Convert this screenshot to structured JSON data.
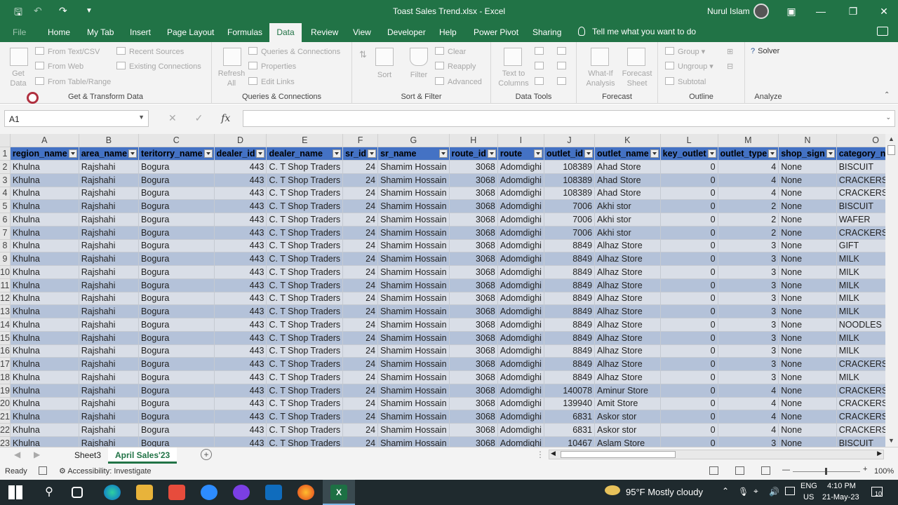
{
  "window": {
    "title": "Toast Sales Trend.xlsx  -  Excel",
    "user": "Nurul Islam"
  },
  "tabs": [
    "File",
    "Home",
    "My Tab",
    "Insert",
    "Page Layout",
    "Formulas",
    "Data",
    "Review",
    "View",
    "Developer",
    "Help",
    "Power Pivot",
    "Sharing"
  ],
  "tell_me": "Tell me what you want to do",
  "ribbon": {
    "get_data": "Get\nData",
    "from_text_csv": "From Text/CSV",
    "from_web": "From Web",
    "from_table": "From Table/Range",
    "recent_sources": "Recent Sources",
    "existing_connections": "Existing Connections",
    "refresh_all": "Refresh\nAll",
    "queries_connections": "Queries & Connections",
    "properties": "Properties",
    "edit_links": "Edit Links",
    "sort": "Sort",
    "filter": "Filter",
    "clear": "Clear",
    "reapply": "Reapply",
    "advanced": "Advanced",
    "text_to_columns": "Text to\nColumns",
    "what_if": "What-If\nAnalysis",
    "forecast_sheet": "Forecast\nSheet",
    "group": "Group",
    "ungroup": "Ungroup",
    "subtotal": "Subtotal",
    "solver": "Solver",
    "groups": {
      "get_transform": "Get & Transform Data",
      "queries": "Queries & Connections",
      "sort_filter": "Sort & Filter",
      "data_tools": "Data Tools",
      "forecast": "Forecast",
      "outline": "Outline",
      "analyze": "Analyze"
    }
  },
  "namebox": "A1",
  "fx": "fx",
  "columns": [
    "A",
    "B",
    "C",
    "D",
    "E",
    "F",
    "G",
    "H",
    "I",
    "J",
    "K",
    "L",
    "M",
    "N",
    "O"
  ],
  "headers": [
    "region_name",
    "area_name",
    "teritorry_name",
    "dealer_id",
    "dealer_name",
    "sr_id",
    "sr_name",
    "route_id",
    "route",
    "outlet_id",
    "outlet_name",
    "key_outlet",
    "outlet_type",
    "shop_sign",
    "category_name"
  ],
  "rows": [
    [
      "Khulna",
      "Rajshahi",
      "Bogura",
      "443",
      "C. T Shop Traders",
      "24",
      "Shamim Hossain",
      "3068",
      "Adomdighi",
      "108389",
      "Ahad Store",
      "0",
      "4",
      "None",
      "BISCUIT"
    ],
    [
      "Khulna",
      "Rajshahi",
      "Bogura",
      "443",
      "C. T Shop Traders",
      "24",
      "Shamim Hossain",
      "3068",
      "Adomdighi",
      "108389",
      "Ahad Store",
      "0",
      "4",
      "None",
      "CRACKERS"
    ],
    [
      "Khulna",
      "Rajshahi",
      "Bogura",
      "443",
      "C. T Shop Traders",
      "24",
      "Shamim Hossain",
      "3068",
      "Adomdighi",
      "108389",
      "Ahad Store",
      "0",
      "4",
      "None",
      "CRACKERS"
    ],
    [
      "Khulna",
      "Rajshahi",
      "Bogura",
      "443",
      "C. T Shop Traders",
      "24",
      "Shamim Hossain",
      "3068",
      "Adomdighi",
      "7006",
      "Akhi stor",
      "0",
      "2",
      "None",
      "BISCUIT"
    ],
    [
      "Khulna",
      "Rajshahi",
      "Bogura",
      "443",
      "C. T Shop Traders",
      "24",
      "Shamim Hossain",
      "3068",
      "Adomdighi",
      "7006",
      "Akhi stor",
      "0",
      "2",
      "None",
      "WAFER"
    ],
    [
      "Khulna",
      "Rajshahi",
      "Bogura",
      "443",
      "C. T Shop Traders",
      "24",
      "Shamim Hossain",
      "3068",
      "Adomdighi",
      "7006",
      "Akhi stor",
      "0",
      "2",
      "None",
      "CRACKERS"
    ],
    [
      "Khulna",
      "Rajshahi",
      "Bogura",
      "443",
      "C. T Shop Traders",
      "24",
      "Shamim Hossain",
      "3068",
      "Adomdighi",
      "8849",
      "Alhaz Store",
      "0",
      "3",
      "None",
      "GIFT"
    ],
    [
      "Khulna",
      "Rajshahi",
      "Bogura",
      "443",
      "C. T Shop Traders",
      "24",
      "Shamim Hossain",
      "3068",
      "Adomdighi",
      "8849",
      "Alhaz Store",
      "0",
      "3",
      "None",
      "MILK"
    ],
    [
      "Khulna",
      "Rajshahi",
      "Bogura",
      "443",
      "C. T Shop Traders",
      "24",
      "Shamim Hossain",
      "3068",
      "Adomdighi",
      "8849",
      "Alhaz Store",
      "0",
      "3",
      "None",
      "MILK"
    ],
    [
      "Khulna",
      "Rajshahi",
      "Bogura",
      "443",
      "C. T Shop Traders",
      "24",
      "Shamim Hossain",
      "3068",
      "Adomdighi",
      "8849",
      "Alhaz Store",
      "0",
      "3",
      "None",
      "MILK"
    ],
    [
      "Khulna",
      "Rajshahi",
      "Bogura",
      "443",
      "C. T Shop Traders",
      "24",
      "Shamim Hossain",
      "3068",
      "Adomdighi",
      "8849",
      "Alhaz Store",
      "0",
      "3",
      "None",
      "MILK"
    ],
    [
      "Khulna",
      "Rajshahi",
      "Bogura",
      "443",
      "C. T Shop Traders",
      "24",
      "Shamim Hossain",
      "3068",
      "Adomdighi",
      "8849",
      "Alhaz Store",
      "0",
      "3",
      "None",
      "MILK"
    ],
    [
      "Khulna",
      "Rajshahi",
      "Bogura",
      "443",
      "C. T Shop Traders",
      "24",
      "Shamim Hossain",
      "3068",
      "Adomdighi",
      "8849",
      "Alhaz Store",
      "0",
      "3",
      "None",
      "NOODLES"
    ],
    [
      "Khulna",
      "Rajshahi",
      "Bogura",
      "443",
      "C. T Shop Traders",
      "24",
      "Shamim Hossain",
      "3068",
      "Adomdighi",
      "8849",
      "Alhaz Store",
      "0",
      "3",
      "None",
      "MILK"
    ],
    [
      "Khulna",
      "Rajshahi",
      "Bogura",
      "443",
      "C. T Shop Traders",
      "24",
      "Shamim Hossain",
      "3068",
      "Adomdighi",
      "8849",
      "Alhaz Store",
      "0",
      "3",
      "None",
      "MILK"
    ],
    [
      "Khulna",
      "Rajshahi",
      "Bogura",
      "443",
      "C. T Shop Traders",
      "24",
      "Shamim Hossain",
      "3068",
      "Adomdighi",
      "8849",
      "Alhaz Store",
      "0",
      "3",
      "None",
      "CRACKERS"
    ],
    [
      "Khulna",
      "Rajshahi",
      "Bogura",
      "443",
      "C. T Shop Traders",
      "24",
      "Shamim Hossain",
      "3068",
      "Adomdighi",
      "8849",
      "Alhaz Store",
      "0",
      "3",
      "None",
      "MILK"
    ],
    [
      "Khulna",
      "Rajshahi",
      "Bogura",
      "443",
      "C. T Shop Traders",
      "24",
      "Shamim Hossain",
      "3068",
      "Adomdighi",
      "140078",
      "Aminur Store",
      "0",
      "4",
      "None",
      "CRACKERS"
    ],
    [
      "Khulna",
      "Rajshahi",
      "Bogura",
      "443",
      "C. T Shop Traders",
      "24",
      "Shamim Hossain",
      "3068",
      "Adomdighi",
      "139940",
      "Amit Store",
      "0",
      "4",
      "None",
      "CRACKERS"
    ],
    [
      "Khulna",
      "Rajshahi",
      "Bogura",
      "443",
      "C. T Shop Traders",
      "24",
      "Shamim Hossain",
      "3068",
      "Adomdighi",
      "6831",
      "Askor stor",
      "0",
      "4",
      "None",
      "CRACKERS"
    ],
    [
      "Khulna",
      "Rajshahi",
      "Bogura",
      "443",
      "C. T Shop Traders",
      "24",
      "Shamim Hossain",
      "3068",
      "Adomdighi",
      "6831",
      "Askor stor",
      "0",
      "4",
      "None",
      "CRACKERS"
    ],
    [
      "Khulna",
      "Rajshahi",
      "Bogura",
      "443",
      "C. T Shop Traders",
      "24",
      "Shamim Hossain",
      "3068",
      "Adomdighi",
      "10467",
      "Aslam Store",
      "0",
      "3",
      "None",
      "BISCUIT"
    ]
  ],
  "sheets": [
    "Sheet3",
    "April Sales'23"
  ],
  "status": {
    "ready": "Ready",
    "accessibility": "Accessibility: Investigate",
    "zoom": "100%"
  },
  "taskbar": {
    "weather": "95°F  Mostly cloudy",
    "lang1": "ENG",
    "lang2": "US",
    "time": "4:10 PM",
    "date": "21-May-23",
    "notif": "10"
  }
}
